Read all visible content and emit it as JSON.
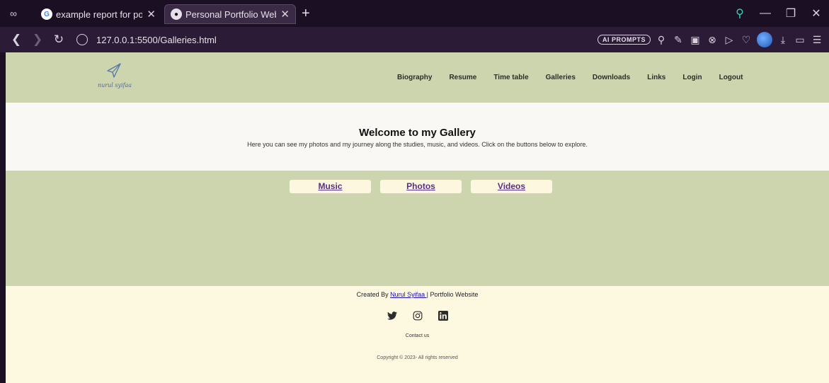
{
  "browser": {
    "tabs": [
      {
        "title": "example report for portfoli",
        "active": false,
        "favicon": "google-icon"
      },
      {
        "title": "Personal Portfolio Website",
        "active": true,
        "favicon": "globe-icon"
      }
    ],
    "url": "127.0.0.1:5500/Galleries.html",
    "ai_prompts_label": "AI PROMPTS"
  },
  "site": {
    "logo_text": "nurul syifaa",
    "nav": [
      "Biography",
      "Resume",
      "Time table",
      "Galleries",
      "Downloads",
      "Links",
      "Login",
      "Logout"
    ],
    "hero": {
      "title": "Welcome to my Gallery",
      "subtitle": "Here you can see my photos and my journey along the studies, music, and videos. Click on the buttons below to explore."
    },
    "gallery_buttons": [
      "Music",
      "Photos",
      "Videos"
    ],
    "footer": {
      "credit_prefix": "Created By ",
      "credit_link": "Nurul Syifaa |",
      "credit_suffix": " Portfolio Website",
      "social": [
        "twitter-icon",
        "instagram-icon",
        "linkedin-icon"
      ],
      "contact": "Contact us",
      "copyright": "Copyright © 2023- All rights reserved"
    }
  },
  "colors": {
    "header_bg": "#ccd5ae",
    "hero_bg": "#faf8f4",
    "footer_bg": "#fdf9e0",
    "button_text": "#5a2d8c",
    "browser_bg": "#1b0f23",
    "accent": "#35d0b8"
  }
}
